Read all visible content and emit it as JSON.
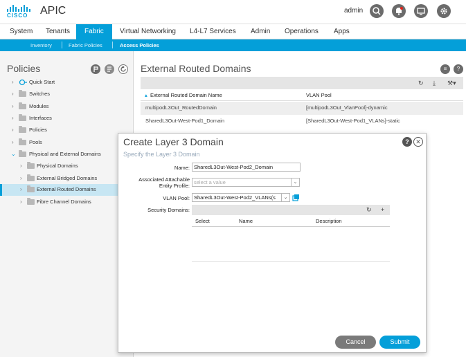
{
  "app": {
    "brand": "CISCO",
    "title": "APIC",
    "user": "admin"
  },
  "header_icons": [
    "search-icon",
    "bell-icon",
    "monitor-icon",
    "gear-icon"
  ],
  "nav": {
    "items": [
      "System",
      "Tenants",
      "Fabric",
      "Virtual Networking",
      "L4-L7 Services",
      "Admin",
      "Operations",
      "Apps"
    ],
    "active": "Fabric"
  },
  "subnav": {
    "items": [
      "Inventory",
      "Fabric Policies",
      "Access Policies"
    ],
    "active": "Access Policies"
  },
  "left": {
    "title": "Policies",
    "tree": [
      {
        "label": "Quick Start",
        "level": 0,
        "icon": "quickstart-icon"
      },
      {
        "label": "Switches",
        "level": 0,
        "icon": "folder-icon"
      },
      {
        "label": "Modules",
        "level": 0,
        "icon": "folder-icon"
      },
      {
        "label": "Interfaces",
        "level": 0,
        "icon": "folder-icon"
      },
      {
        "label": "Policies",
        "level": 0,
        "icon": "folder-icon"
      },
      {
        "label": "Pools",
        "level": 0,
        "icon": "folder-icon"
      },
      {
        "label": "Physical and External Domains",
        "level": 0,
        "icon": "folder-icon",
        "expanded": true
      },
      {
        "label": "Physical Domains",
        "level": 1,
        "icon": "folder-icon"
      },
      {
        "label": "External Bridged Domains",
        "level": 1,
        "icon": "folder-icon"
      },
      {
        "label": "External Routed Domains",
        "level": 1,
        "icon": "folder-icon",
        "selected": true
      },
      {
        "label": "Fibre Channel Domains",
        "level": 1,
        "icon": "folder-icon"
      }
    ]
  },
  "content": {
    "title": "External Routed Domains",
    "columns": [
      "External Routed Domain Name",
      "VLAN Pool"
    ],
    "rows": [
      [
        "multipodL3Out_RoutedDomain",
        "[multipodL3Out_VlanPool]-dynamic"
      ],
      [
        "SharedL3Out-West-Pod1_Domain",
        "[SharedL3Out-West-Pod1_VLANs]-static"
      ]
    ]
  },
  "dialog": {
    "title": "Create Layer 3 Domain",
    "subtitle": "Specify the Layer 3 Domain",
    "name_label": "Name:",
    "name_value": "SharedL3Out-West-Pod2_Domain",
    "aep_label_1": "Associated Attachable",
    "aep_label_2": "Entity Profile:",
    "aep_placeholder": "select a value",
    "vlan_label": "VLAN Pool:",
    "vlan_value": "SharedL3Out-West-Pod2_VLANs(s",
    "security_label": "Security Domains:",
    "security_columns": [
      "Select",
      "Name",
      "Description"
    ],
    "cancel": "Cancel",
    "submit": "Submit"
  },
  "colors": {
    "accent": "#049fd9",
    "selected_row": "#c7e6f3",
    "cancel": "#7a7a7a"
  }
}
